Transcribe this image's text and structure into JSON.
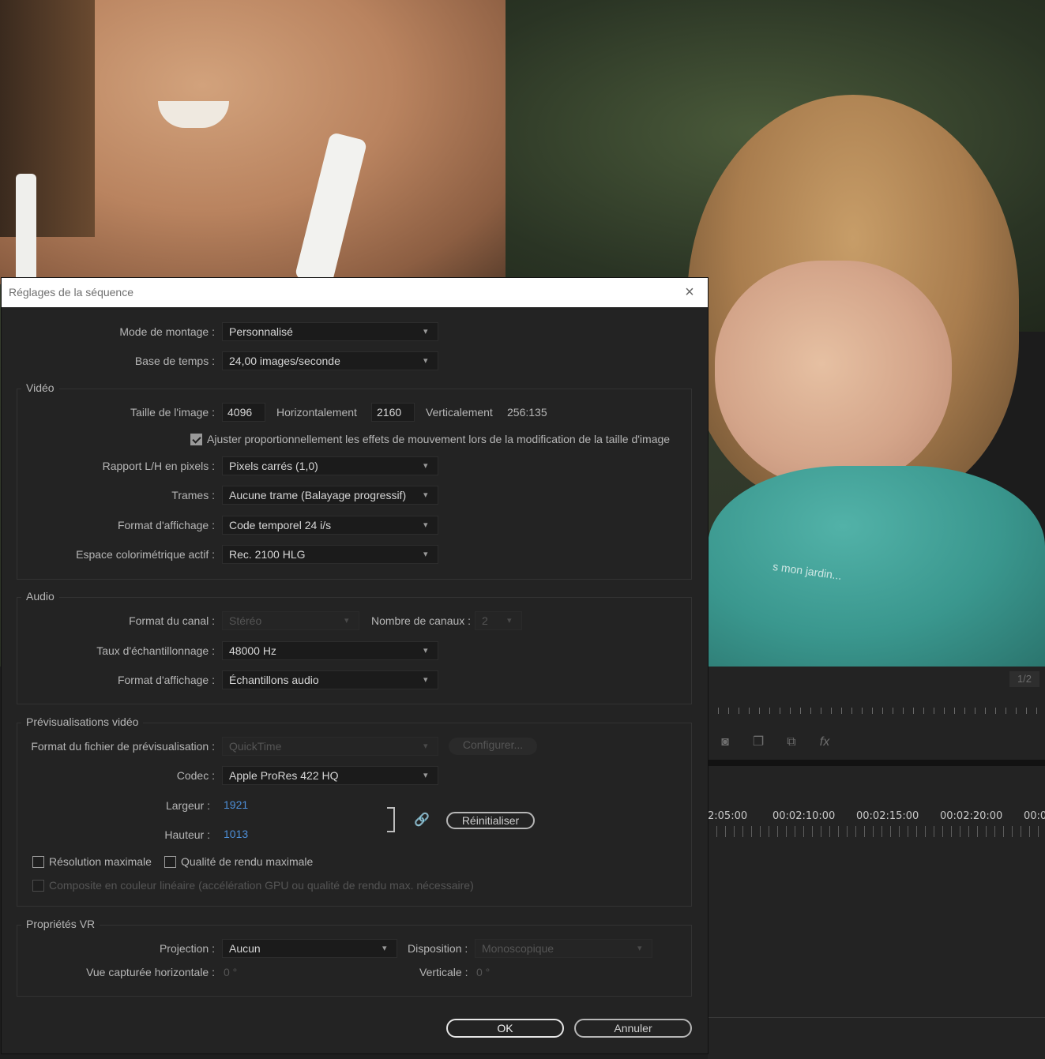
{
  "dialog": {
    "title": "Réglages de la séquence",
    "close_glyph": "×"
  },
  "general": {
    "mode_label": "Mode de montage :",
    "mode_value": "Personnalisé",
    "timebase_label": "Base de temps :",
    "timebase_value": "24,00  images/seconde"
  },
  "video": {
    "section_title": "Vidéo",
    "frame_size_label": "Taille de l'image :",
    "width_value": "4096",
    "horizontal_label": "Horizontalement",
    "height_value": "2160",
    "vertical_label": "Verticalement",
    "aspect_ratio": "256:135",
    "scale_checkbox_label": "Ajuster proportionnellement les effets de mouvement lors de la modification de la taille d'image",
    "scale_checked": true,
    "pixel_aspect_label": "Rapport L/H en pixels :",
    "pixel_aspect_value": "Pixels carrés (1,0)",
    "fields_label": "Trames :",
    "fields_value": "Aucune trame (Balayage progressif)",
    "display_format_label": "Format d'affichage :",
    "display_format_value": "Code temporel 24 i/s",
    "color_space_label": "Espace colorimétrique actif :",
    "color_space_value": "Rec. 2100 HLG"
  },
  "audio": {
    "section_title": "Audio",
    "channel_format_label": "Format du canal :",
    "channel_format_value": "Stéréo",
    "channel_count_label": "Nombre de canaux :",
    "channel_count_value": "2",
    "sample_rate_label": "Taux d'échantillonnage :",
    "sample_rate_value": "48000 Hz",
    "display_format_label": "Format d'affichage :",
    "display_format_value": "Échantillons audio"
  },
  "previews": {
    "section_title": "Prévisualisations vidéo",
    "file_format_label": "Format du fichier de prévisualisation :",
    "file_format_value": "QuickTime",
    "configure_label": "Configurer...",
    "codec_label": "Codec :",
    "codec_value": "Apple ProRes 422 HQ",
    "width_label": "Largeur :",
    "width_value": "1921",
    "height_label": "Hauteur :",
    "height_value": "1013",
    "reset_label": "Réinitialiser",
    "max_res_label": "Résolution maximale",
    "max_quality_label": "Qualité de rendu maximale",
    "linear_label": "Composite en couleur linéaire (accélération GPU ou qualité de rendu max. nécessaire)"
  },
  "vr": {
    "section_title": "Propriétés VR",
    "projection_label": "Projection :",
    "projection_value": "Aucun",
    "layout_label": "Disposition :",
    "layout_value": "Monoscopique",
    "h_fov_label": "Vue capturée horizontale :",
    "h_fov_value": "0 °",
    "v_fov_label": "Verticale :",
    "v_fov_value": "0 °"
  },
  "footer": {
    "ok_label": "OK",
    "cancel_label": "Annuler"
  },
  "background": {
    "shirt_text": "s mon jardin...",
    "page_indicator": "1/2",
    "timecodes": [
      "2:05:00",
      "00:02:10:00",
      "00:02:15:00",
      "00:02:20:00",
      "00:0"
    ]
  }
}
